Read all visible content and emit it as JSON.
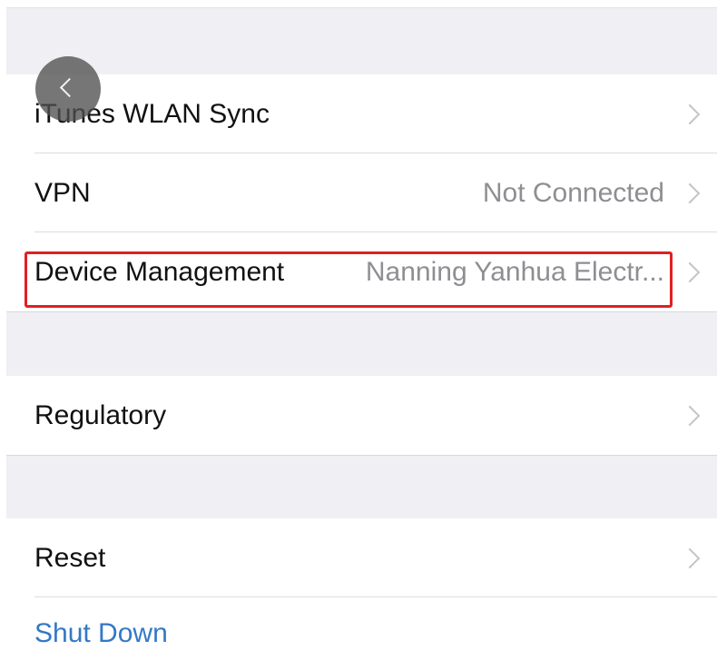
{
  "settings": {
    "rows": {
      "itunes": {
        "label": "iTunes WLAN Sync"
      },
      "vpn": {
        "label": "VPN",
        "value": "Not Connected"
      },
      "device_management": {
        "label": "Device Management",
        "value": "Nanning Yanhua Electr..."
      },
      "regulatory": {
        "label": "Regulatory"
      },
      "reset": {
        "label": "Reset"
      },
      "shut_down": {
        "label": "Shut Down"
      }
    }
  },
  "icons": {
    "back": "chevron-left-icon",
    "disclosure": "chevron-right-icon"
  },
  "colors": {
    "group_background": "#efeff4",
    "cell_background": "#ffffff",
    "label_text": "#111111",
    "secondary_text": "#8e8e93",
    "destructive_link": "#3478c6",
    "highlight": "#e02020"
  }
}
